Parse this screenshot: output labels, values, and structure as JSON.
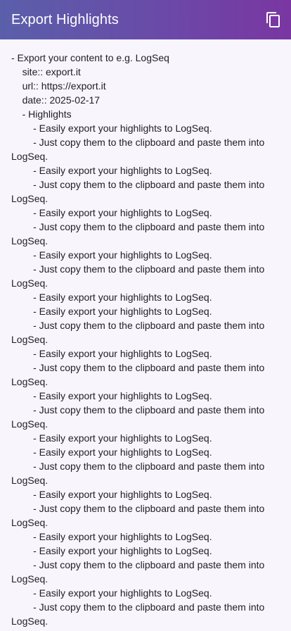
{
  "app_bar": {
    "title": "Export Highlights",
    "copy_icon": "copy-icon",
    "gradient_start": "#5a5faa",
    "gradient_end": "#7a36a2"
  },
  "content": {
    "lines": [
      "- Export your content to e.g. LogSeq",
      "    site:: export.it",
      "    url:: https://export.it",
      "    date:: 2025-02-17",
      "    - Highlights",
      "        - Easily export your highlights to LogSeq.",
      "        - Just copy them to the clipboard and paste them into LogSeq.",
      "        - Easily export your highlights to LogSeq.",
      "        - Just copy them to the clipboard and paste them into LogSeq.",
      "        - Easily export your highlights to LogSeq.",
      "        - Just copy them to the clipboard and paste them into LogSeq.",
      "        - Easily export your highlights to LogSeq.",
      "        - Just copy them to the clipboard and paste them into LogSeq.",
      "        - Easily export your highlights to LogSeq.",
      "        - Easily export your highlights to LogSeq.",
      "        - Just copy them to the clipboard and paste them into LogSeq.",
      "        - Easily export your highlights to LogSeq.",
      "        - Just copy them to the clipboard and paste them into LogSeq.",
      "        - Easily export your highlights to LogSeq.",
      "        - Just copy them to the clipboard and paste them into LogSeq.",
      "        - Easily export your highlights to LogSeq.",
      "        - Easily export your highlights to LogSeq.",
      "        - Just copy them to the clipboard and paste them into LogSeq.",
      "        - Easily export your highlights to LogSeq.",
      "        - Just copy them to the clipboard and paste them into LogSeq.",
      "        - Easily export your highlights to LogSeq.",
      "        - Easily export your highlights to LogSeq.",
      "        - Just copy them to the clipboard and paste them into LogSeq.",
      "        - Easily export your highlights to LogSeq.",
      "        - Just copy them to the clipboard and paste them into LogSeq."
    ]
  }
}
